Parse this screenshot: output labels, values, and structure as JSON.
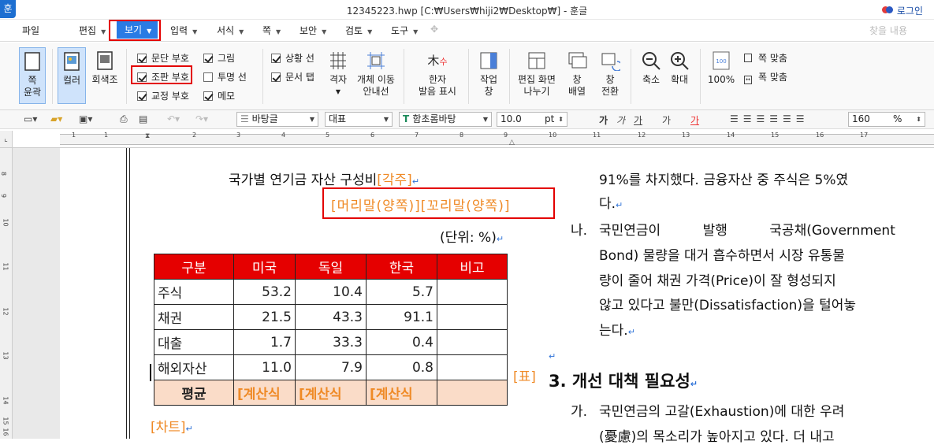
{
  "window": {
    "app_icon": "훈",
    "title": "12345223.hwp [C:₩Users₩hiji2₩Desktop₩] - 훈글",
    "login": "로그인"
  },
  "menu": {
    "items": [
      "파일",
      "편집",
      "보기",
      "입력",
      "서식",
      "쪽",
      "보안",
      "검토",
      "도구"
    ],
    "search_placeholder": "찾을 내용"
  },
  "ribbon": {
    "page_outline": [
      "쪽",
      "윤곽"
    ],
    "color": "컬러",
    "grayscale": "회색조",
    "checks_col1": [
      {
        "label": "문단 부호",
        "checked": true
      },
      {
        "label": "조판 부호",
        "checked": true
      },
      {
        "label": "교정 부호",
        "checked": true
      }
    ],
    "checks_col2": [
      {
        "label": "그림",
        "checked": true
      },
      {
        "label": "투명 선",
        "checked": false
      },
      {
        "label": "메모",
        "checked": true
      }
    ],
    "checks_col3": [
      {
        "label": "상황 선",
        "checked": true
      },
      {
        "label": "문서 탭",
        "checked": true
      }
    ],
    "grid": "격자",
    "object_move": [
      "개체 이동",
      "안내선"
    ],
    "hanja": [
      "한자",
      "발음 표시"
    ],
    "work_window": [
      "작업",
      "창"
    ],
    "split_screen": [
      "편집 화면",
      "나누기"
    ],
    "arrange": [
      "창",
      "배열"
    ],
    "switch": [
      "창",
      "전환"
    ],
    "zoom_out": "축소",
    "zoom_in": "확대",
    "zoom_100": "100%",
    "fit_page": "쪽 맞춤",
    "fit_width": "폭 맞춤"
  },
  "format_bar": {
    "style": "바탕글",
    "font_lang": "대표",
    "font": "함초롬바탕",
    "size": "10.0",
    "unit": "pt",
    "zoom": "160",
    "zoom_unit": "%",
    "char_buttons": [
      "가",
      "가",
      "가",
      "가",
      "가"
    ]
  },
  "ruler": {
    "h_numbers": [
      "1",
      "1",
      "2",
      "3",
      "4",
      "5",
      "6",
      "7",
      "8",
      "9",
      "10",
      "11",
      "12",
      "13",
      "14",
      "15",
      "16",
      "17"
    ],
    "v_numbers": [
      "8",
      "9",
      "10",
      "11",
      "12",
      "13",
      "14",
      "15",
      "16"
    ]
  },
  "document": {
    "left": {
      "title": "국가별 연기금 자산 구성비",
      "title_tag": "[각주]",
      "header_footer": "[머리말(양쪽)][꼬리말(양쪽)]",
      "unit": "(단위: %)",
      "table": {
        "headers": [
          "구분",
          "미국",
          "독일",
          "한국",
          "비고"
        ],
        "rows": [
          [
            "주식",
            "53.2",
            "10.4",
            "5.7",
            ""
          ],
          [
            "채권",
            "21.5",
            "43.3",
            "91.1",
            ""
          ],
          [
            "대출",
            "1.7",
            "33.3",
            "0.4",
            ""
          ],
          [
            "해외자산",
            "11.0",
            "7.9",
            "0.8",
            ""
          ]
        ],
        "avg": [
          "평균",
          "[계산식",
          "[계산식",
          "[계산식",
          ""
        ]
      },
      "table_tag": "[표]",
      "chart_tag": "[차트]"
    },
    "right": {
      "line1": "91%를 차지했다. 금융자산 중 주식은 5%였",
      "line2": "다.",
      "item_na_marker": "나.",
      "item_na": [
        "국민연금이 발행 국공채(Government",
        "Bond) 물량을 대거 흡수하면서 시장 유통물",
        "량이 줄어 채권 가격(Price)이 잘 형성되지",
        "않고 있다고 불만(Dissatisfaction)을 털어놓",
        "는다."
      ],
      "heading": "3. 개선 대책 필요성",
      "item_ga_marker": "가.",
      "item_ga": [
        "국민연금의 고갈(Exhaustion)에 대한 우려",
        "(憂慮)의 목소리가 높아지고 있다. 더 내고"
      ]
    }
  },
  "colors": {
    "accent": "#2a7be4",
    "highlight_red": "#e30000",
    "table_header": "#e50000",
    "avg_row": "#fadcc8",
    "tag_orange": "#ef8a26"
  }
}
